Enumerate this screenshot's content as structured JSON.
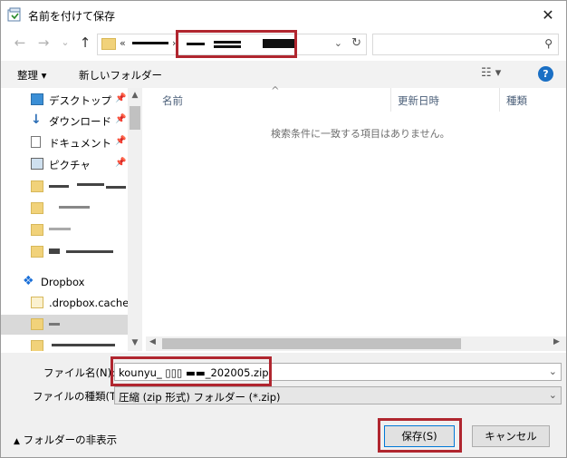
{
  "window": {
    "title": "名前を付けて保存",
    "close_label": "✕"
  },
  "nav_buttons": {
    "back": "←",
    "forward": "→",
    "recent": "⌄",
    "up": "↑"
  },
  "address": {
    "crumb": "«",
    "separator": "›",
    "dropdown": "⌄",
    "refresh": "↻"
  },
  "search": {
    "placeholder": "",
    "icon": "⚲"
  },
  "toolbar": {
    "organize": "整理 ▾",
    "new_folder": "新しいフォルダー",
    "view": "☷ ▾",
    "help": "?"
  },
  "sidebar": {
    "items": [
      {
        "label": "デスクトップ",
        "icon": "desktop-icon",
        "pinned": true
      },
      {
        "label": "ダウンロード",
        "icon": "download-icon",
        "pinned": true
      },
      {
        "label": "ドキュメント",
        "icon": "document-icon",
        "pinned": true
      },
      {
        "label": "ピクチャ",
        "icon": "pictures-icon",
        "pinned": true
      },
      {
        "label": "",
        "icon": "folder-sync-icon"
      },
      {
        "label": "",
        "icon": "folder-icon"
      },
      {
        "label": "",
        "icon": "folder-icon"
      },
      {
        "label": "",
        "icon": "folder-sync-icon"
      },
      {
        "label": "Dropbox",
        "icon": "dropbox-icon"
      },
      {
        "label": ".dropbox.cache",
        "icon": "folder-icon"
      },
      {
        "label": "",
        "icon": "shared-folder-icon"
      },
      {
        "label": "",
        "icon": "shared-folder-icon"
      }
    ],
    "pin_glyph": "📌"
  },
  "file_list": {
    "columns": [
      "名前",
      "更新日時",
      "種類"
    ],
    "sort_indicator": "^",
    "empty_message": "検索条件に一致する項目はありません。"
  },
  "form": {
    "filename_label": "ファイル名(N):",
    "filename_value": "kounyu_ ▯▯▯ ▬▬_202005.zip",
    "filetype_label": "ファイルの種類(T):",
    "filetype_value": "圧縮 (zip 形式) フォルダー (*.zip)",
    "hide_folders": "フォルダーの非表示",
    "save_button": "保存(S)",
    "cancel_button": "キャンセル"
  },
  "colors": {
    "highlight": "#b0262f",
    "accent": "#0078d7"
  }
}
